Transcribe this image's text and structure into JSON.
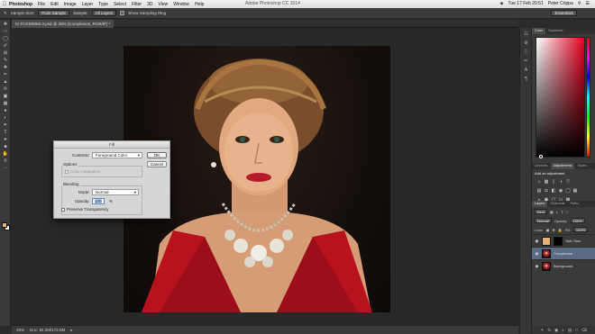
{
  "menubar": {
    "apple": "",
    "app_name": "Photoshop",
    "menus": [
      "File",
      "Edit",
      "Image",
      "Layer",
      "Type",
      "Select",
      "Filter",
      "3D",
      "View",
      "Window",
      "Help"
    ],
    "document_title": "Adobe Photoshop CC 2014",
    "clock": "Tue 17 Feb  20:51",
    "user": "Peter Crippa"
  },
  "options_bar": {
    "sample_size_label": "Sample Size:",
    "sample_size_value": "Point Sample",
    "sample_label": "Sample:",
    "sample_value": "All Layers",
    "sampling_ring_label": "Show Sampling Ring",
    "workspace": "Essentials"
  },
  "document_tab": {
    "label": "IV FOXD9056-3.psd @ 25% (Complexion, RGB/8*) *"
  },
  "status_bar": {
    "zoom": "25%",
    "doc_size": "Doc: 84.2M/172.8M"
  },
  "fill_dialog": {
    "title": "Fill",
    "contents_label": "Contents:",
    "contents_value": "Foreground Color",
    "options_label": "Options",
    "color_adaptation_label": "Color Adaptation",
    "blending_label": "Blending",
    "mode_label": "Mode:",
    "mode_value": "Normal",
    "opacity_label": "Opacity:",
    "opacity_value": "100",
    "opacity_unit": "%",
    "preserve_transparency_label": "Preserve Transparency",
    "ok_label": "OK",
    "cancel_label": "Cancel"
  },
  "color_panel": {
    "tabs": [
      "Color",
      "Swatches"
    ],
    "foreground_color": "#e5b07a",
    "hue_color": "#e8001e"
  },
  "adjustments_panel": {
    "tabs": [
      "Libraries",
      "Adjustments",
      "Styles"
    ],
    "title": "Add an adjustment"
  },
  "layers_panel": {
    "tabs": [
      "Layers",
      "Channels",
      "Paths"
    ],
    "kind_value": "Kind",
    "blend_mode": "Normal",
    "opacity_label": "Opacity:",
    "opacity_value": "100%",
    "lock_label": "Lock:",
    "fill_label": "Fill:",
    "fill_value": "100%",
    "layers": [
      {
        "name": "Skin Tone",
        "selected": false
      },
      {
        "name": "Complexion",
        "selected": true
      },
      {
        "name": "Background",
        "selected": false
      }
    ]
  },
  "colors": {
    "foreground": "#e5b07a",
    "background": "#ffffff",
    "selection": "#5b6b85"
  }
}
